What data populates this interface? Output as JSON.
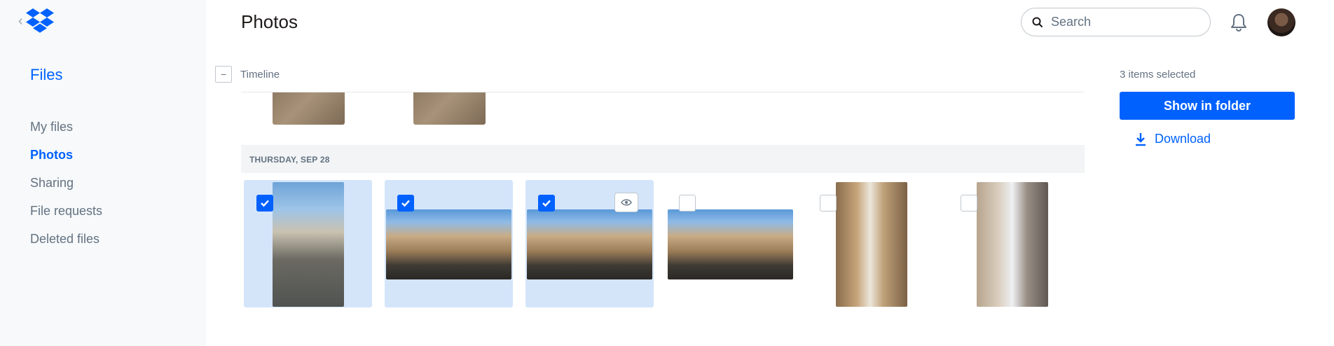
{
  "sidebar": {
    "brand_link": "Files",
    "items": [
      {
        "label": "My files",
        "active": false
      },
      {
        "label": "Photos",
        "active": true
      },
      {
        "label": "Sharing",
        "active": false
      },
      {
        "label": "File requests",
        "active": false
      },
      {
        "label": "Deleted files",
        "active": false
      }
    ]
  },
  "header": {
    "title": "Photos",
    "search_placeholder": "Search"
  },
  "timeline": {
    "label": "Timeline",
    "group_date": "THURSDAY, SEP 28",
    "photos": [
      {
        "kind": "portrait-street",
        "selected": true
      },
      {
        "kind": "landscape-crowd",
        "selected": true
      },
      {
        "kind": "landscape-crowd",
        "selected": true
      },
      {
        "kind": "landscape-crowd",
        "selected": false
      },
      {
        "kind": "portrait-alley",
        "selected": false
      },
      {
        "kind": "portrait-alley",
        "selected": false
      }
    ]
  },
  "selection_panel": {
    "count_text": "3 items selected",
    "show_in_folder": "Show in folder",
    "download": "Download"
  },
  "colors": {
    "accent": "#0061fe",
    "selected_tile": "#d4e5fa",
    "sidebar_bg": "#f7f9fa"
  }
}
